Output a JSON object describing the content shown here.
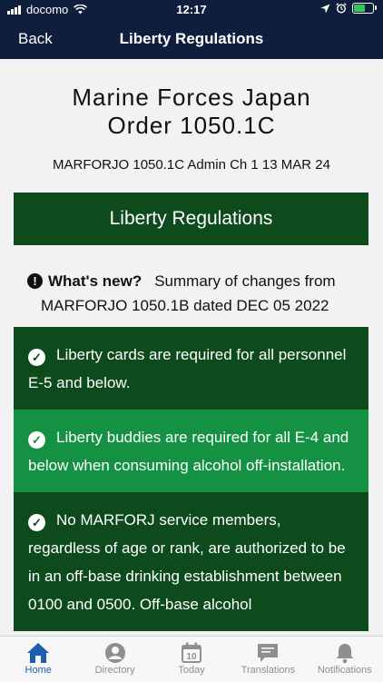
{
  "status_bar": {
    "carrier": "docomo",
    "time": "12:17"
  },
  "nav": {
    "back_label": "Back",
    "title": "Liberty Regulations"
  },
  "document": {
    "title_line1": "Marine Forces Japan",
    "title_line2": "Order 1050.1C",
    "subtitle": "MARFORJO 1050.1C Admin Ch 1 13 MAR 24"
  },
  "banner": {
    "label": "Liberty Regulations"
  },
  "whats_new": {
    "label": "What's new?",
    "line1": "Summary of changes from",
    "line2": "MARFORJO 1050.1B dated DEC 05 2022"
  },
  "changes": [
    {
      "text": "Liberty cards are required for all personnel E-5 and below."
    },
    {
      "text": "Liberty buddies are required for all E-4 and below when consuming alcohol off-installation."
    },
    {
      "text": "No MARFORJ service members, regardless of age or rank, are authorized to be in an off-base drinking establishment between 0100 and 0500. Off-base alcohol"
    }
  ],
  "tabs": [
    {
      "label": "Home",
      "icon": "home-icon",
      "active": true
    },
    {
      "label": "Directory",
      "icon": "person-icon"
    },
    {
      "label": "Today",
      "icon": "calendar-icon",
      "date": "10"
    },
    {
      "label": "Translations",
      "icon": "chat-bubble-icon"
    },
    {
      "label": "Notifications",
      "icon": "bell-icon"
    }
  ],
  "colors": {
    "nav_bg": "#0f1e3c",
    "banner_green": "#0d4a1c",
    "item_light_green": "#149142",
    "tab_active": "#1d5fae",
    "tab_inactive": "#8e8e93"
  }
}
